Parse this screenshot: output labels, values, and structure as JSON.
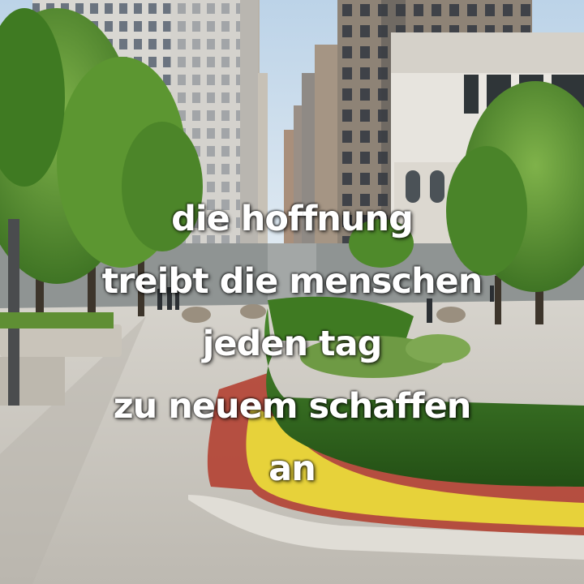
{
  "quote": {
    "lines": [
      "die hoffnung",
      "treibt die menschen",
      "jeden tag",
      "zu neuem schaffen",
      "an"
    ]
  },
  "colors": {
    "sky": "#c9dceb",
    "foliage": "#4f8a2b",
    "hedge": "#2f6a1e",
    "pavement": "#c9c6c0",
    "flowers_yellow": "#e7d23a",
    "flowers_red": "#b23a2a",
    "text": "#ffffff"
  }
}
